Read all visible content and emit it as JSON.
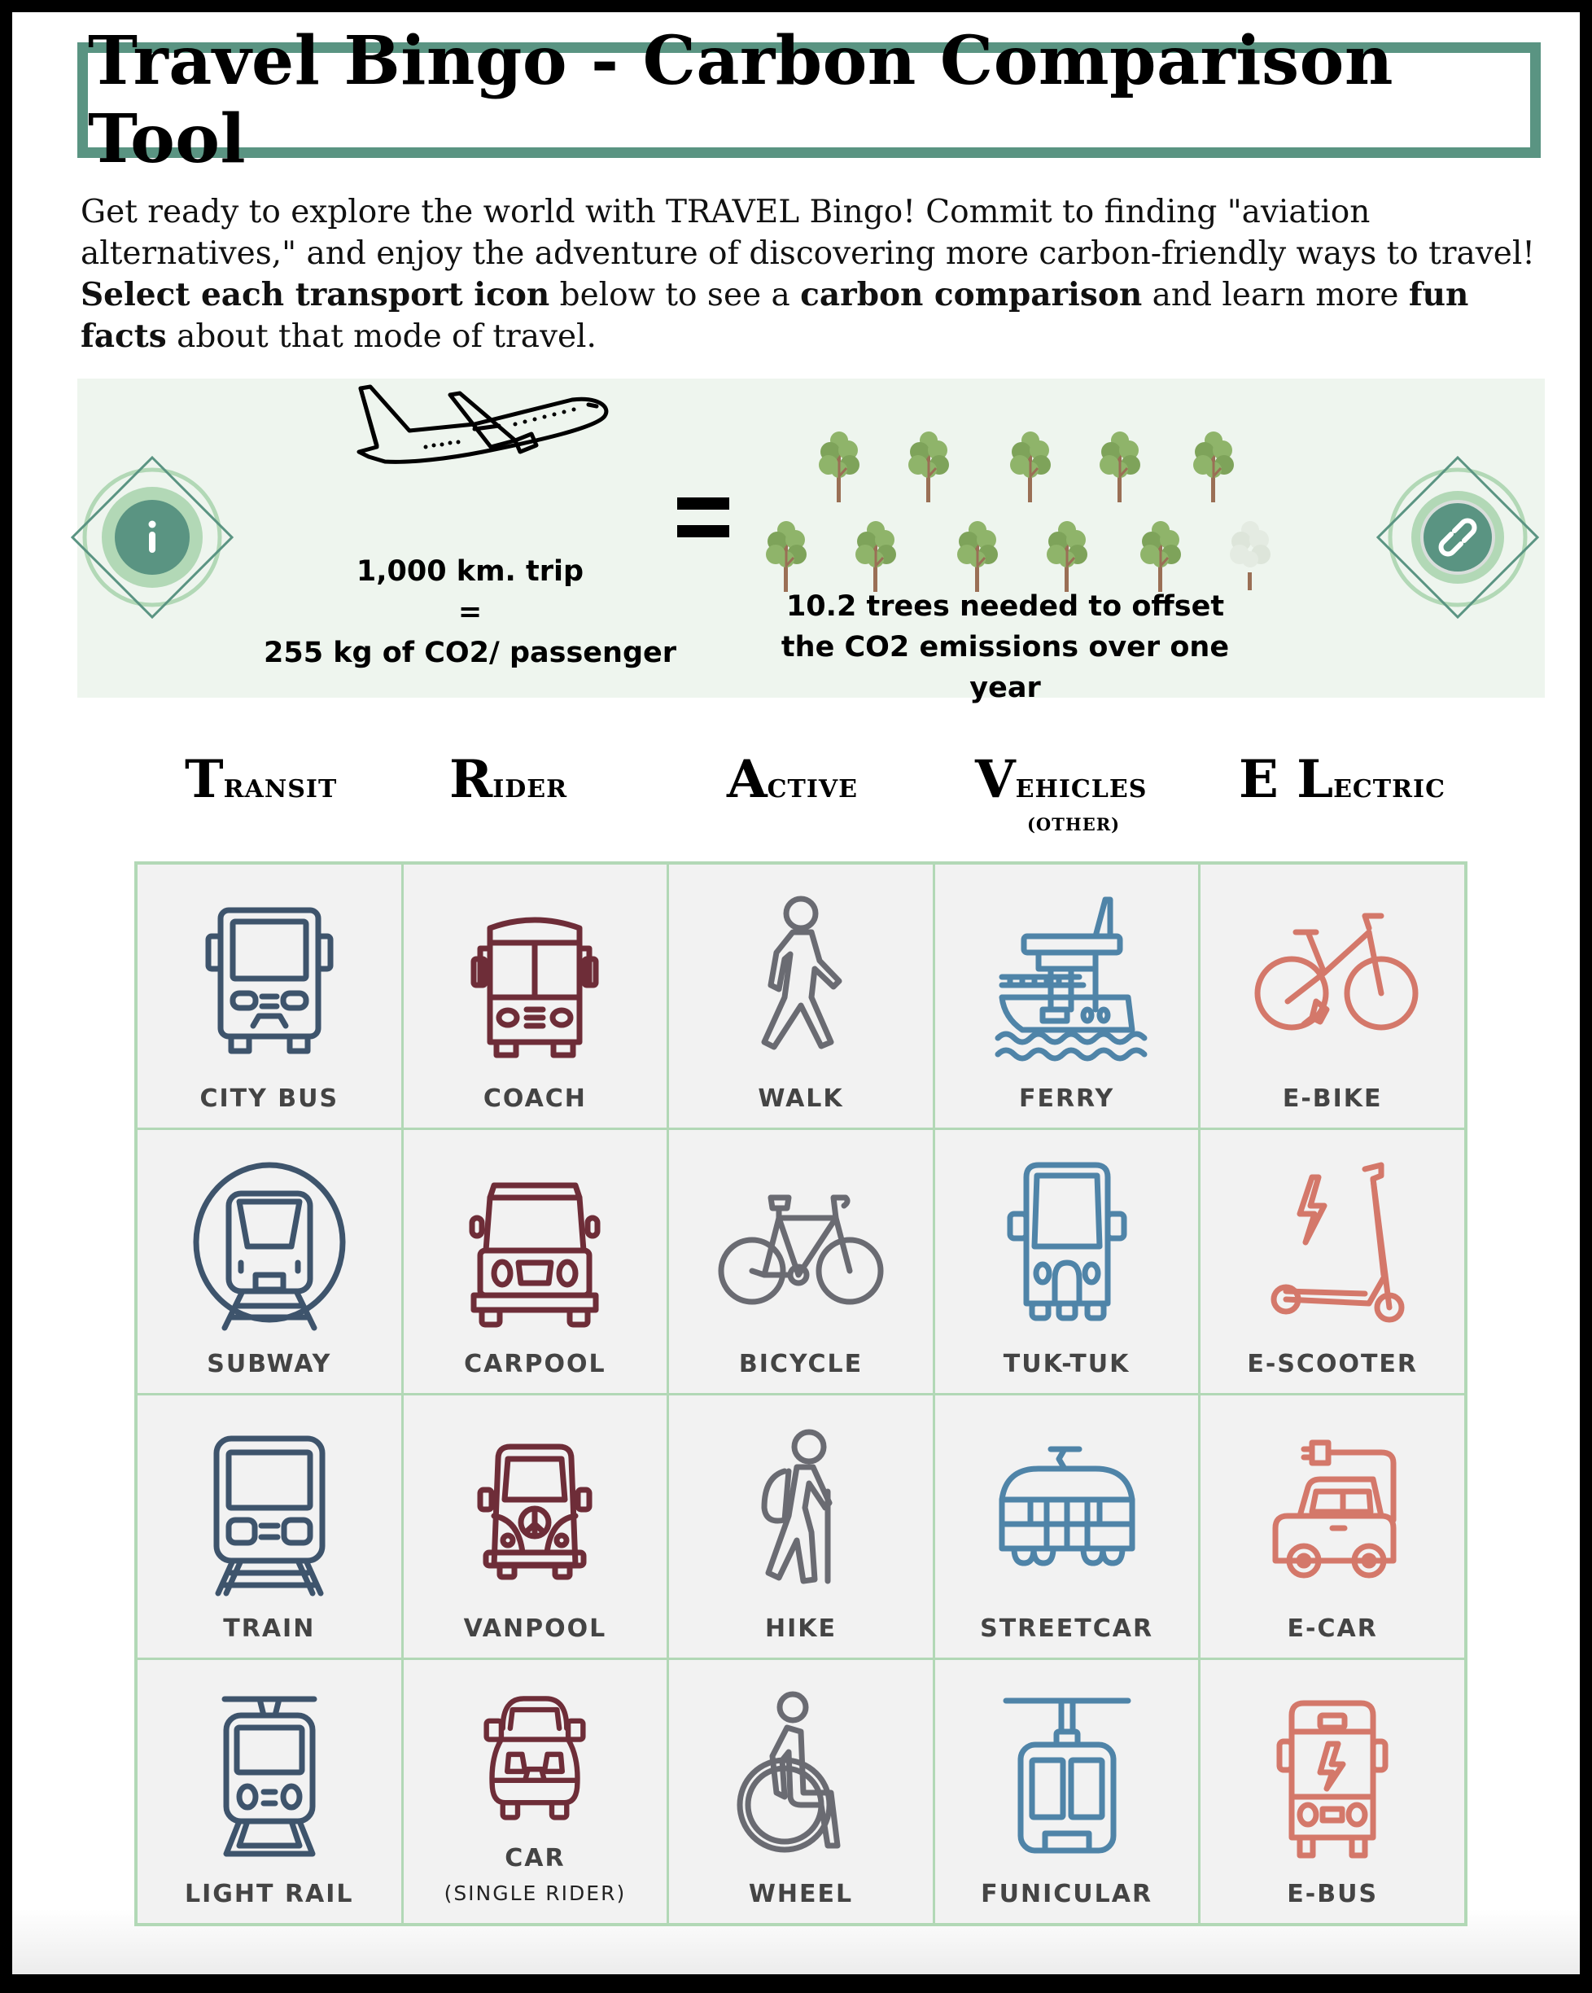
{
  "title": "Travel Bingo - Carbon Comparison Tool",
  "intro": {
    "line1": "Get ready to explore the world with TRAVEL Bingo! Commit to finding \"aviation alternatives,\" and enjoy the adventure of discovering more carbon-friendly ways to travel!",
    "bold1": "Select each transport icon",
    "mid1": " below to see a ",
    "bold2": "carbon comparison",
    "mid2": " and learn more ",
    "bold3": "fun facts",
    "end": " about that mode of travel."
  },
  "comparison": {
    "trip_line1": "1,000 km. trip",
    "trip_line2": "=",
    "trip_line3": "255 kg of CO2/ passenger",
    "trees_line1": "10.2 trees needed to offset",
    "trees_line2": "the CO2 emissions over one year",
    "trees_count": 10.2,
    "info_icon": "info-icon",
    "link_icon": "link-icon"
  },
  "colors": {
    "brand_green": "#5a9482",
    "light_green": "#b2d8b6",
    "panel_bg": "#eef5ee",
    "transit": "#3e546c",
    "rider": "#6e2d38",
    "active": "#6a6b72",
    "vehicles": "#4f84a8",
    "electric": "#d4786a"
  },
  "categories": [
    {
      "initial": "T",
      "rest": "RANSIT",
      "sub": ""
    },
    {
      "initial": "R",
      "rest": "IDER",
      "sub": ""
    },
    {
      "initial": "A",
      "rest": "CTIVE",
      "sub": ""
    },
    {
      "initial": "V",
      "rest": "EHICLES",
      "sub": "(OTHER)"
    },
    {
      "initial": "E L",
      "rest": "ECTRIC",
      "sub": ""
    }
  ],
  "grid": [
    [
      {
        "label": "CITY BUS",
        "icon": "city-bus-icon"
      },
      {
        "label": "COACH",
        "icon": "coach-icon"
      },
      {
        "label": "WALK",
        "icon": "walk-icon"
      },
      {
        "label": "FERRY",
        "icon": "ferry-icon"
      },
      {
        "label": "E-BIKE",
        "icon": "e-bike-icon"
      }
    ],
    [
      {
        "label": "SUBWAY",
        "icon": "subway-icon"
      },
      {
        "label": "CARPOOL",
        "icon": "carpool-icon"
      },
      {
        "label": "BICYCLE",
        "icon": "bicycle-icon"
      },
      {
        "label": "TUK-TUK",
        "icon": "tuk-tuk-icon"
      },
      {
        "label": "E-SCOOTER",
        "icon": "e-scooter-icon"
      }
    ],
    [
      {
        "label": "TRAIN",
        "icon": "train-icon"
      },
      {
        "label": "VANPOOL",
        "icon": "vanpool-icon"
      },
      {
        "label": "HIKE",
        "icon": "hike-icon"
      },
      {
        "label": "STREETCAR",
        "icon": "streetcar-icon"
      },
      {
        "label": "E-CAR",
        "icon": "e-car-icon"
      }
    ],
    [
      {
        "label": "LIGHT RAIL",
        "icon": "light-rail-icon"
      },
      {
        "label": "CAR",
        "sublabel": "(SINGLE RIDER)",
        "icon": "car-icon"
      },
      {
        "label": "WHEEL",
        "icon": "wheelchair-icon"
      },
      {
        "label": "FUNICULAR",
        "icon": "funicular-icon"
      },
      {
        "label": "E-BUS",
        "icon": "e-bus-icon"
      }
    ]
  ]
}
